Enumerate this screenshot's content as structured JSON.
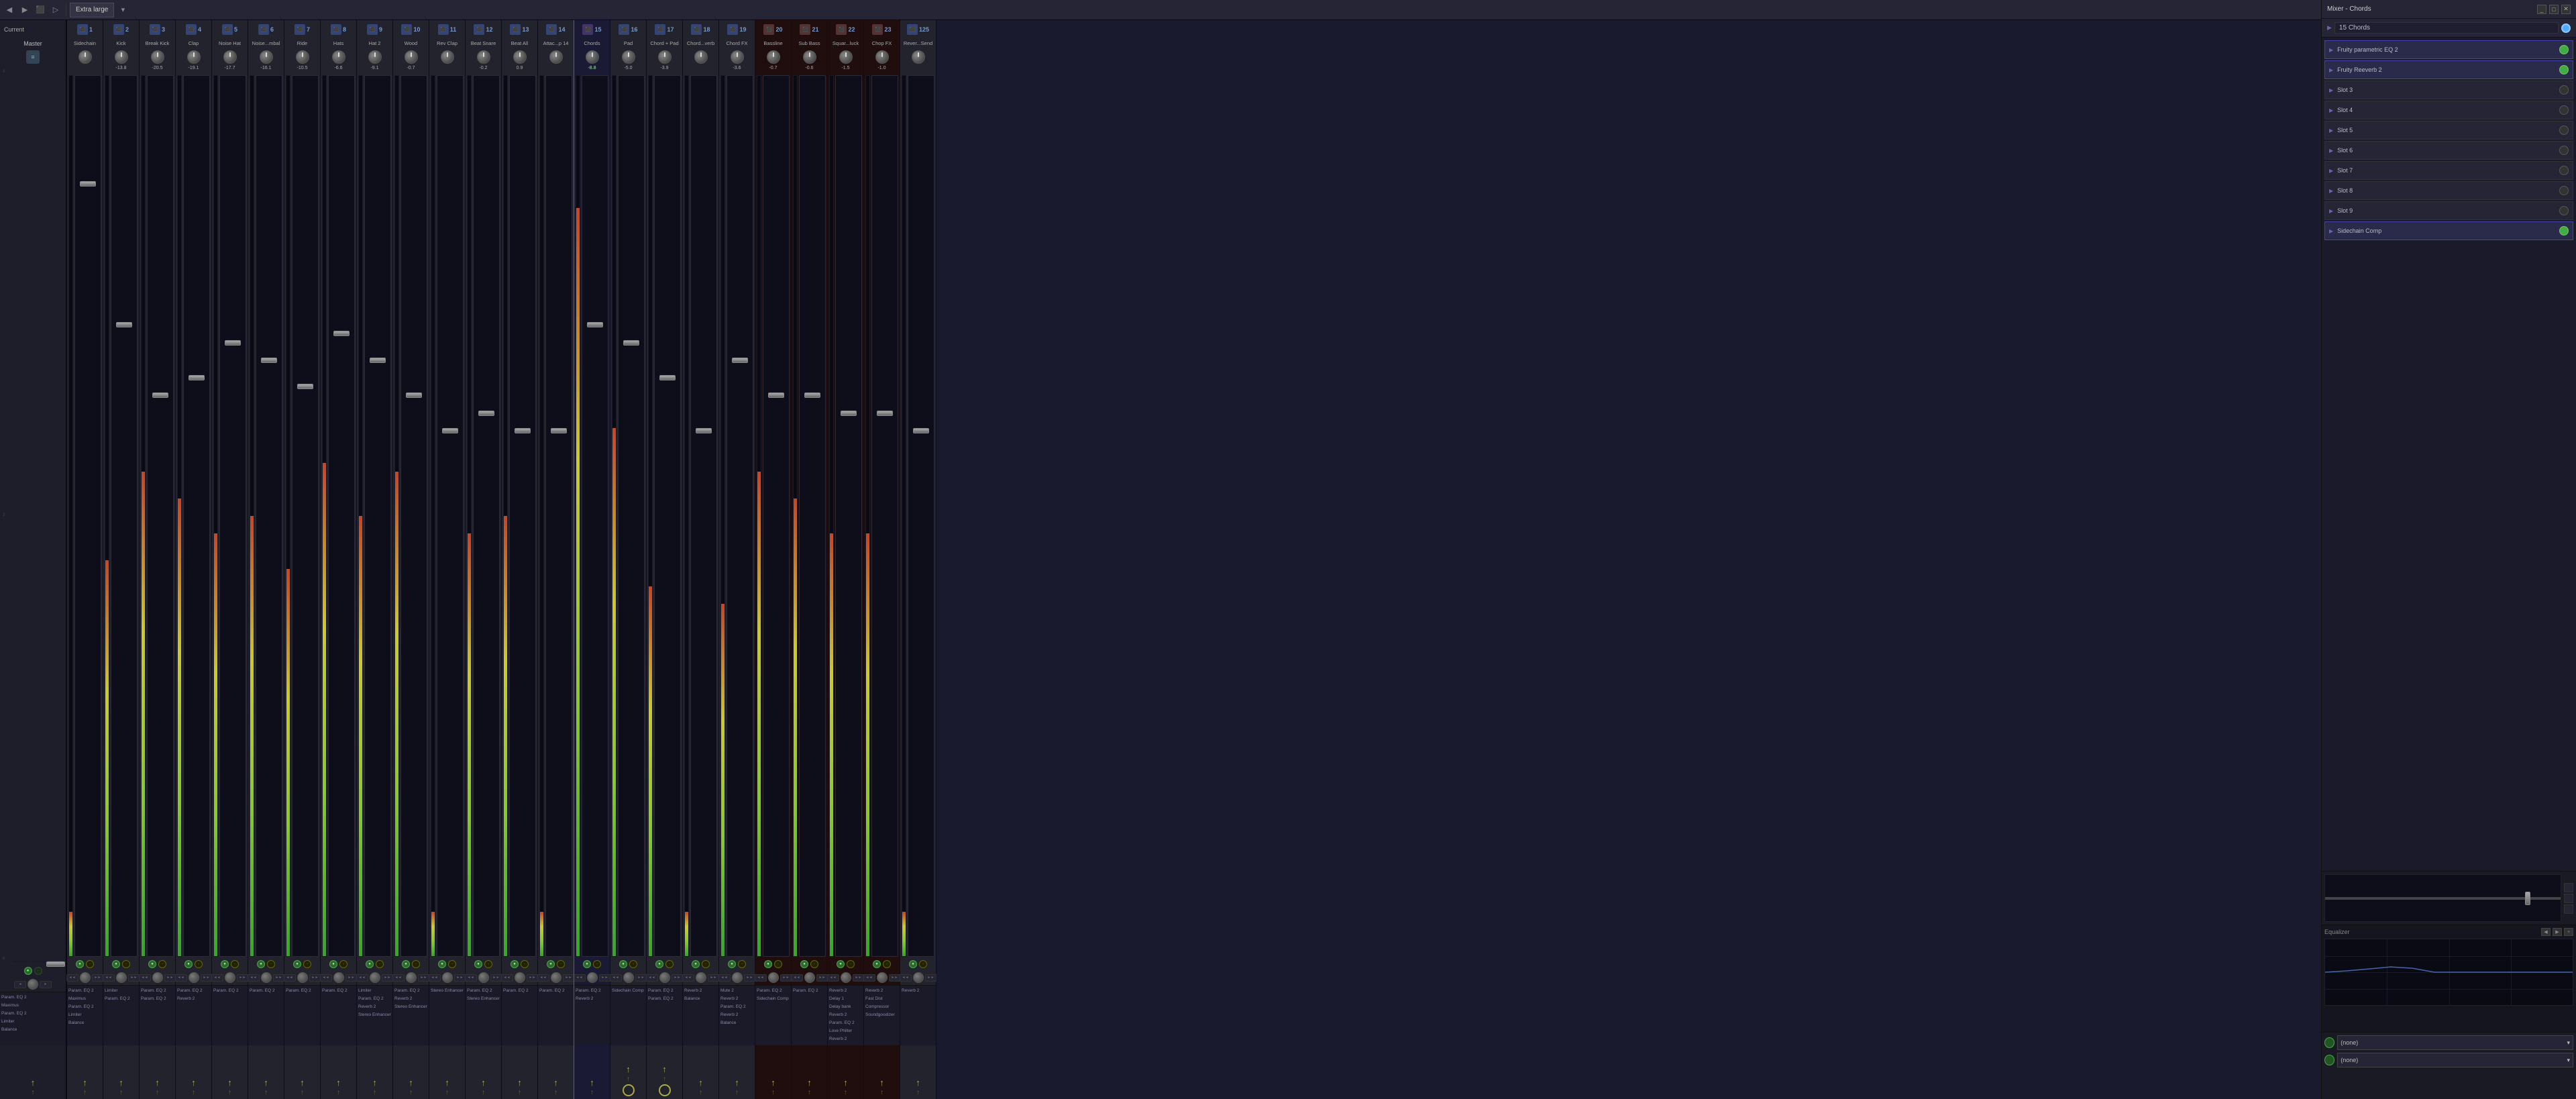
{
  "app": {
    "title": "Mixer - Chords",
    "toolbar": {
      "extra_large_label": "Extra large",
      "icons": [
        "◀",
        "▶",
        "⬛",
        "⚡",
        "♦"
      ]
    }
  },
  "colors": {
    "bg_main": "#1e1e2e",
    "bg_channel": "#252535",
    "bg_master": "#1e1e2a",
    "bg_bassline": "#200e0e",
    "bg_chords": "#0e0e22",
    "accent_blue": "#4466aa",
    "accent_green": "#44aa22",
    "accent_yellow": "#aaaa22",
    "accent_red": "#aa3333",
    "text_primary": "#cccccc",
    "text_dim": "#888888"
  },
  "right_panel": {
    "title": "Mixer - Chords",
    "selected_channel": "15 Chords",
    "fx_slots": [
      {
        "name": "Fruity parametric EQ 2",
        "enabled": true,
        "id": 1
      },
      {
        "name": "Fruity Reeverb 2",
        "enabled": true,
        "id": 2
      },
      {
        "name": "Slot 3",
        "enabled": false,
        "id": 3
      },
      {
        "name": "Slot 4",
        "enabled": false,
        "id": 4
      },
      {
        "name": "Slot 5",
        "enabled": false,
        "id": 5
      },
      {
        "name": "Slot 6",
        "enabled": false,
        "id": 6
      },
      {
        "name": "Slot 7",
        "enabled": false,
        "id": 7
      },
      {
        "name": "Slot 8",
        "enabled": false,
        "id": 8
      },
      {
        "name": "Slot 9",
        "enabled": false,
        "id": 9
      },
      {
        "name": "Sidechain Comp",
        "enabled": true,
        "id": 10
      }
    ],
    "eq_label": "Equalizer",
    "routing": {
      "send1_label": "(none)",
      "send2_label": "(none)"
    }
  },
  "channels": {
    "current": {
      "label": "Current",
      "name": "Master"
    },
    "master": {
      "num": "",
      "name": "Master",
      "level": "",
      "icon": "M"
    },
    "strips": [
      {
        "num": "1",
        "name": "Sidechain",
        "level": "",
        "db": "",
        "icon": "◆",
        "type": "normal",
        "fx": [
          "Param. EQ 2",
          "Maximus",
          "Param. EQ 2",
          "Limiter",
          "Balance"
        ]
      },
      {
        "num": "2",
        "name": "Kick",
        "level": "-13.8",
        "db": "-13.8",
        "icon": "◆",
        "type": "normal",
        "fx": [
          "Limiter",
          "Param. EQ 2"
        ]
      },
      {
        "num": "3",
        "name": "Break Kick",
        "level": "-20.5",
        "db": "-20.5",
        "icon": "◆",
        "type": "normal",
        "fx": [
          "Param. EQ 2",
          "Param. EQ 2"
        ]
      },
      {
        "num": "4",
        "name": "Clap",
        "level": "-19.1",
        "db": "-19.1",
        "icon": "◆",
        "type": "normal",
        "fx": [
          "Param. EQ 2",
          "Reverb 2"
        ]
      },
      {
        "num": "5",
        "name": "Noise Hat",
        "level": "-17.7",
        "db": "-17.7",
        "icon": "◆",
        "type": "normal",
        "fx": [
          "Param. EQ 2"
        ]
      },
      {
        "num": "6",
        "name": "Noise...mbal",
        "level": "-16.1",
        "db": "-16.1",
        "icon": "◆",
        "type": "normal",
        "fx": [
          "Param. EQ 2"
        ]
      },
      {
        "num": "7",
        "name": "Ride",
        "level": "-10.5",
        "db": "-10.5",
        "icon": "◆",
        "type": "normal",
        "fx": [
          "Param. EQ 2"
        ]
      },
      {
        "num": "8",
        "name": "Hats",
        "level": "-6.6",
        "db": "-6.6",
        "icon": "◆",
        "type": "normal",
        "fx": [
          "Param. EQ 2"
        ]
      },
      {
        "num": "9",
        "name": "Hat 2",
        "level": "-9.1",
        "db": "-9.1",
        "icon": "◆",
        "type": "normal",
        "fx": [
          "Limiter",
          "Param. EQ 2",
          "Reverb 2",
          "Stereo Enhancer"
        ]
      },
      {
        "num": "10",
        "name": "Wood",
        "level": "-0.7",
        "db": "-0.7",
        "icon": "◆",
        "type": "normal",
        "fx": [
          "Param. EQ 2",
          "Reverb 2",
          "Stereo Enhancer"
        ]
      },
      {
        "num": "11",
        "name": "Rev Clap",
        "level": "",
        "db": "",
        "icon": "◆",
        "type": "normal",
        "fx": [
          "Stereo Enhancer"
        ]
      },
      {
        "num": "12",
        "name": "Beat Snare",
        "level": "-0.2",
        "db": "-0.2",
        "icon": "◆",
        "type": "normal",
        "fx": [
          "Param. EQ 2",
          "Stereo Enhancer"
        ]
      },
      {
        "num": "13",
        "name": "Beat All",
        "level": "0.9",
        "db": "0.9",
        "icon": "◆",
        "type": "normal",
        "fx": [
          "Param. EQ 2"
        ]
      },
      {
        "num": "14",
        "name": "Attac...p 14",
        "level": "",
        "db": "",
        "icon": "◆",
        "type": "normal",
        "fx": [
          "Param. EQ 2"
        ]
      },
      {
        "num": "15",
        "name": "Chords",
        "level": "-8.8",
        "db": "-8.8",
        "icon": "◆",
        "type": "chords",
        "selected": true,
        "fx": [
          "Param. EQ 2",
          "Reverb 2"
        ]
      },
      {
        "num": "16",
        "name": "Pad",
        "level": "-5.0",
        "db": "-5.0",
        "icon": "◆",
        "type": "normal",
        "fx": [
          "Sidechain Comp"
        ]
      },
      {
        "num": "17",
        "name": "Chord + Pad",
        "level": "-3.9",
        "db": "-3.9",
        "icon": "◆",
        "type": "normal",
        "fx": [
          "Param. EQ 2",
          "Param. EQ 2"
        ]
      },
      {
        "num": "18",
        "name": "Chord...verb",
        "level": "",
        "db": "",
        "icon": "◆",
        "type": "normal",
        "fx": [
          "Reverb 2",
          "Balance"
        ]
      },
      {
        "num": "19",
        "name": "Chord FX",
        "level": "-3.6",
        "db": "-3.6",
        "icon": "◆",
        "type": "normal",
        "fx": [
          "Mute 2",
          "Reverb 2",
          "Param. EQ 2",
          "Reverb 2",
          "Balance"
        ]
      },
      {
        "num": "20",
        "name": "Bassline",
        "level": "-0.7",
        "db": "-0.7",
        "icon": "◆",
        "type": "bassline",
        "fx": [
          "Param. EQ 2",
          "Sidechain Comp"
        ]
      },
      {
        "num": "21",
        "name": "Sub Bass",
        "level": "-0.6",
        "db": "-0.6",
        "icon": "◆",
        "type": "bassline",
        "fx": [
          "Param. EQ 2"
        ]
      },
      {
        "num": "22",
        "name": "Squar...luck",
        "level": "-1.5",
        "db": "-1.5",
        "icon": "◆",
        "type": "bassline",
        "fx": [
          "Reverb 2",
          "Delay 1",
          "Delay bank",
          "Reverb 2",
          "Param. EQ 2",
          "Love Philter",
          "Reverb 2"
        ]
      },
      {
        "num": "23",
        "name": "Chop FX",
        "level": "-1.0",
        "db": "-1.0",
        "icon": "◆",
        "type": "bassline",
        "fx": [
          "Reverb 2",
          "Fast Dist",
          "Compressor",
          "Soundgoodizer"
        ]
      },
      {
        "num": "125",
        "name": "Rever...Send",
        "level": "",
        "db": "",
        "icon": "◆",
        "type": "normal",
        "fx": [
          "Reverb 2"
        ]
      }
    ]
  }
}
